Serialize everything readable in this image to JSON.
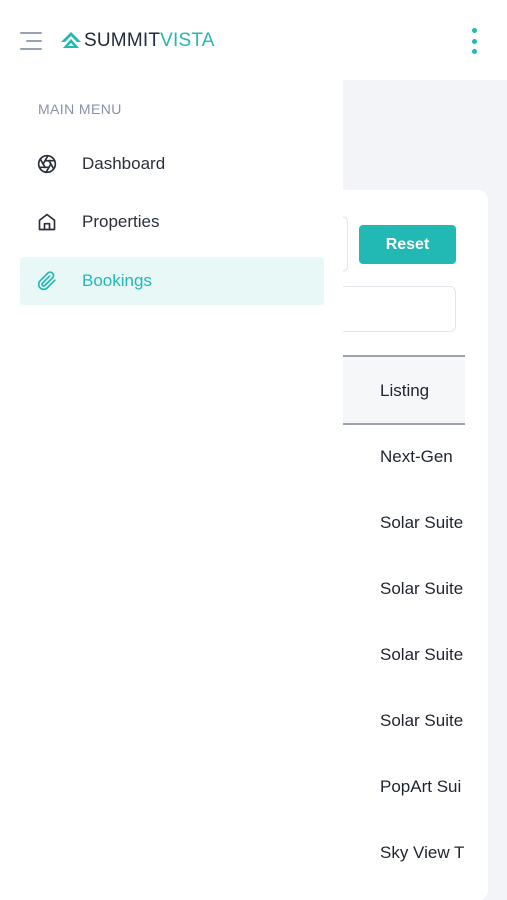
{
  "header": {
    "logo_part1": "SUMMIT",
    "logo_part2": "VISTA",
    "menu_icon": "hamburger-menu-icon",
    "more_icon": "vertical-dots-icon",
    "accent_color": "#22b8b3"
  },
  "sidebar": {
    "section_title": "MAIN MENU",
    "items": [
      {
        "label": "Dashboard",
        "icon": "aperture-icon",
        "active": false
      },
      {
        "label": "Properties",
        "icon": "home-icon",
        "active": false
      },
      {
        "label": "Bookings",
        "icon": "paperclip-icon",
        "active": true
      }
    ]
  },
  "main": {
    "reset_label": "Reset",
    "table": {
      "header": "Listing",
      "rows": [
        "Next-Gen",
        "Solar Suite",
        "Solar Suite",
        "Solar Suite",
        "Solar Suite",
        "PopArt Sui",
        "Sky View T"
      ]
    }
  }
}
